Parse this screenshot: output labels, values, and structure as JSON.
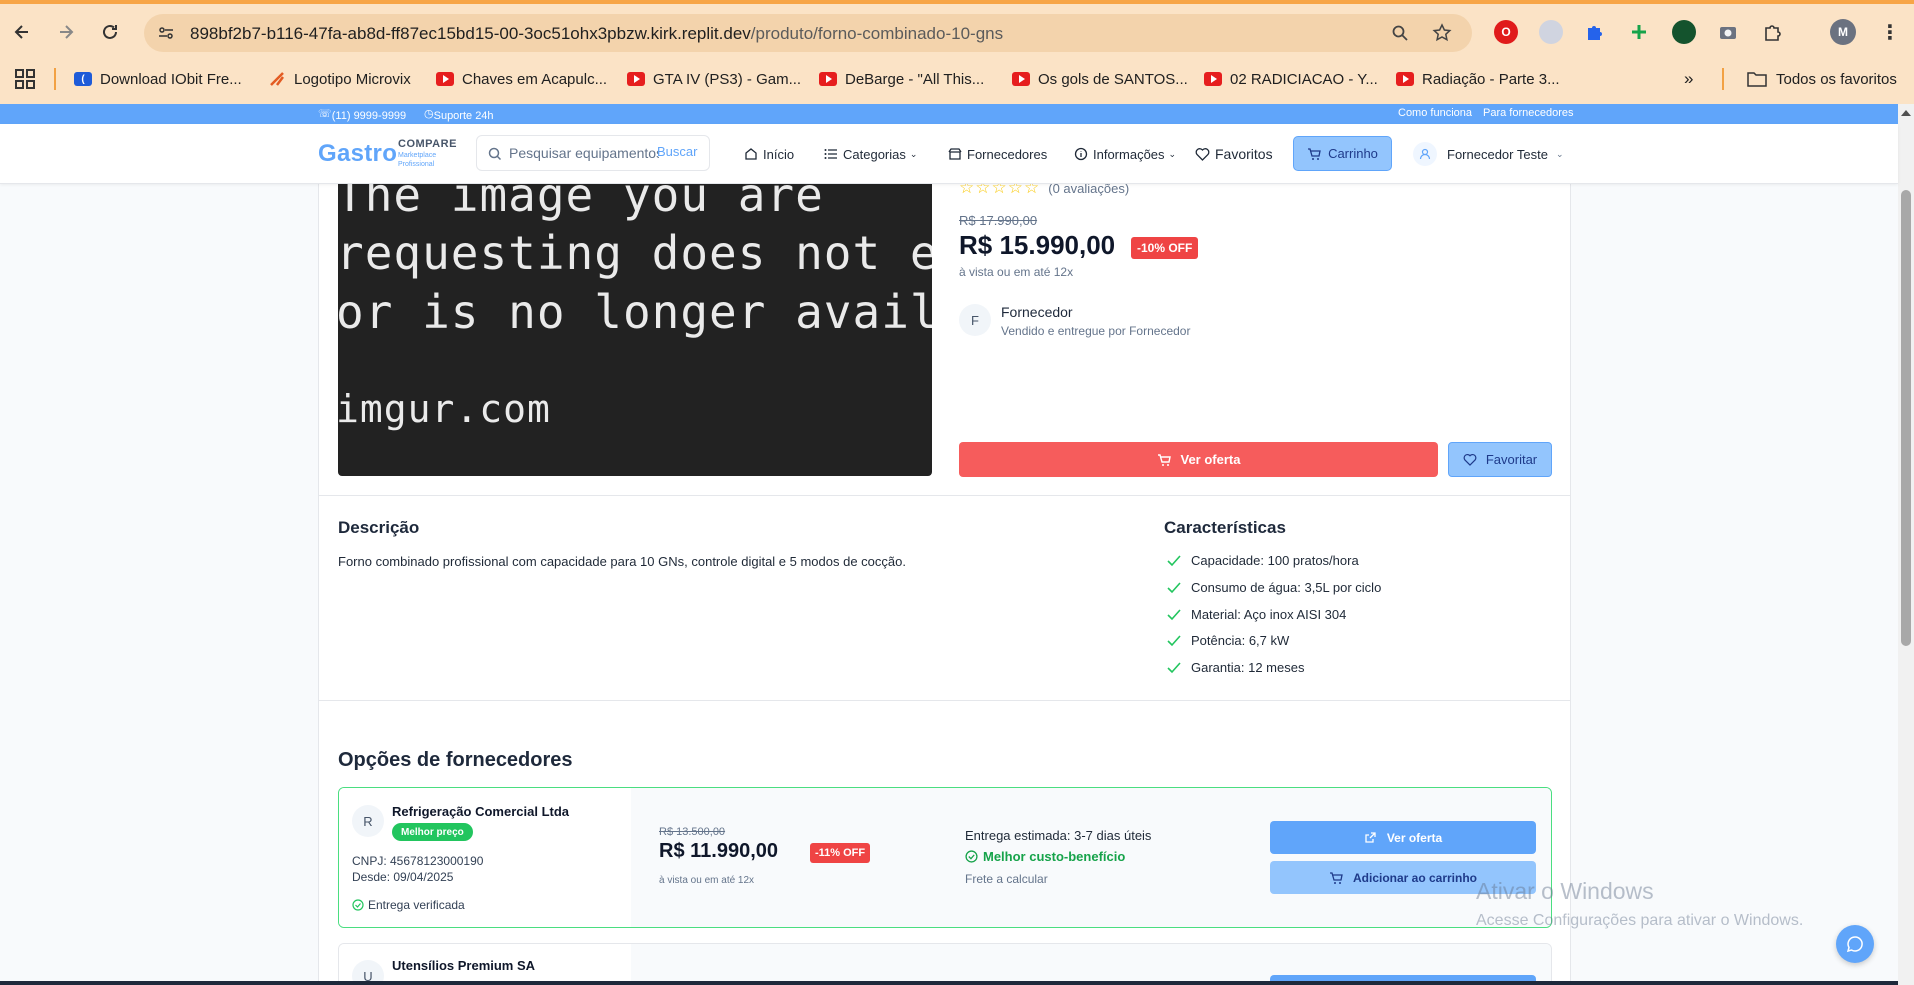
{
  "browser": {
    "url_host": "898bf2b7-b116-47fa-ab8d-ff87ec15bd15-00-3oc51ohx3pbzw.kirk.replit.dev",
    "url_path": "/produto/forno-combinado-10-gns",
    "profile_initial": "M",
    "bookmarks": [
      {
        "label": "Download IObit Fre..."
      },
      {
        "label": "Logotipo Microvix"
      },
      {
        "label": "Chaves em Acapulc..."
      },
      {
        "label": "GTA IV (PS3) - Gam..."
      },
      {
        "label": "DeBarge - \"All This..."
      },
      {
        "label": "Os gols de SANTOS..."
      },
      {
        "label": "02 RADICIACAO - Y..."
      },
      {
        "label": "Radiação - Parte 3..."
      }
    ],
    "all_bookmarks": "Todos os favoritos"
  },
  "topbar": {
    "phone": "(11) 9999-9999",
    "support": "Suporte 24h",
    "how_it_works": "Como funciona",
    "for_suppliers": "Para fornecedores"
  },
  "header": {
    "logo_main": "Gastro",
    "logo_compare": "COMPARE",
    "logo_tag1": "Marketplace",
    "logo_tag2": "Profissional",
    "search_placeholder": "Pesquisar equipamentos...",
    "search_button": "Buscar",
    "nav": {
      "home": "Início",
      "categories": "Categorias",
      "suppliers": "Fornecedores",
      "info": "Informações",
      "favorites": "Favoritos",
      "cart": "Carrinho",
      "user": "Fornecedor Teste"
    }
  },
  "product": {
    "image_text": [
      "The image you are",
      "requesting does not exist",
      "or is no longer available.",
      "imgur.com"
    ],
    "reviews": "(0 avaliações)",
    "rating": 0,
    "old_price": "R$ 17.990,00",
    "price": "R$ 15.990,00",
    "discount": "-10% OFF",
    "installment": "à vista ou em até 12x",
    "supplier_initial": "F",
    "supplier_name": "Fornecedor",
    "supplier_sub": "Vendido e entregue por Fornecedor",
    "btn_offer": "Ver oferta",
    "btn_favorite": "Favoritar",
    "description_title": "Descrição",
    "description": "Forno combinado profissional com capacidade para 10 GNs, controle digital e 5 modos de cocção.",
    "features_title": "Características",
    "features": [
      "Capacidade: 100 pratos/hora",
      "Consumo de água: 3,5L por ciclo",
      "Material: Aço inox AISI 304",
      "Potência: 6,7 kW",
      "Garantia: 12 meses"
    ]
  },
  "offers": {
    "title": "Opções de fornecedores",
    "items": [
      {
        "initial": "R",
        "name": "Refrigeração Comercial Ltda",
        "badge": "Melhor preço",
        "cnpj": "CNPJ: 45678123000190",
        "since": "Desde: 09/04/2025",
        "verified": "Entrega verificada",
        "old_price": "R$ 13.500,00",
        "price": "R$ 11.990,00",
        "discount": "-11% OFF",
        "installment": "à vista ou em até 12x",
        "delivery": "Entrega estimada: 3-7 dias úteis",
        "value": "Melhor custo-benefício",
        "freight": "Frete a calcular",
        "btn_offer": "Ver oferta",
        "btn_cart": "Adicionar ao carrinho"
      },
      {
        "initial": "U",
        "name": "Utensílios Premium SA"
      }
    ]
  },
  "watermark": {
    "line1": "Ativar o Windows",
    "line2": "Acesse Configurações para ativar o Windows."
  },
  "colors": {
    "primary": "#60a5fa",
    "accent_red": "#f65c5c",
    "success": "#22c55e",
    "chrome": "#fbe3c6"
  }
}
